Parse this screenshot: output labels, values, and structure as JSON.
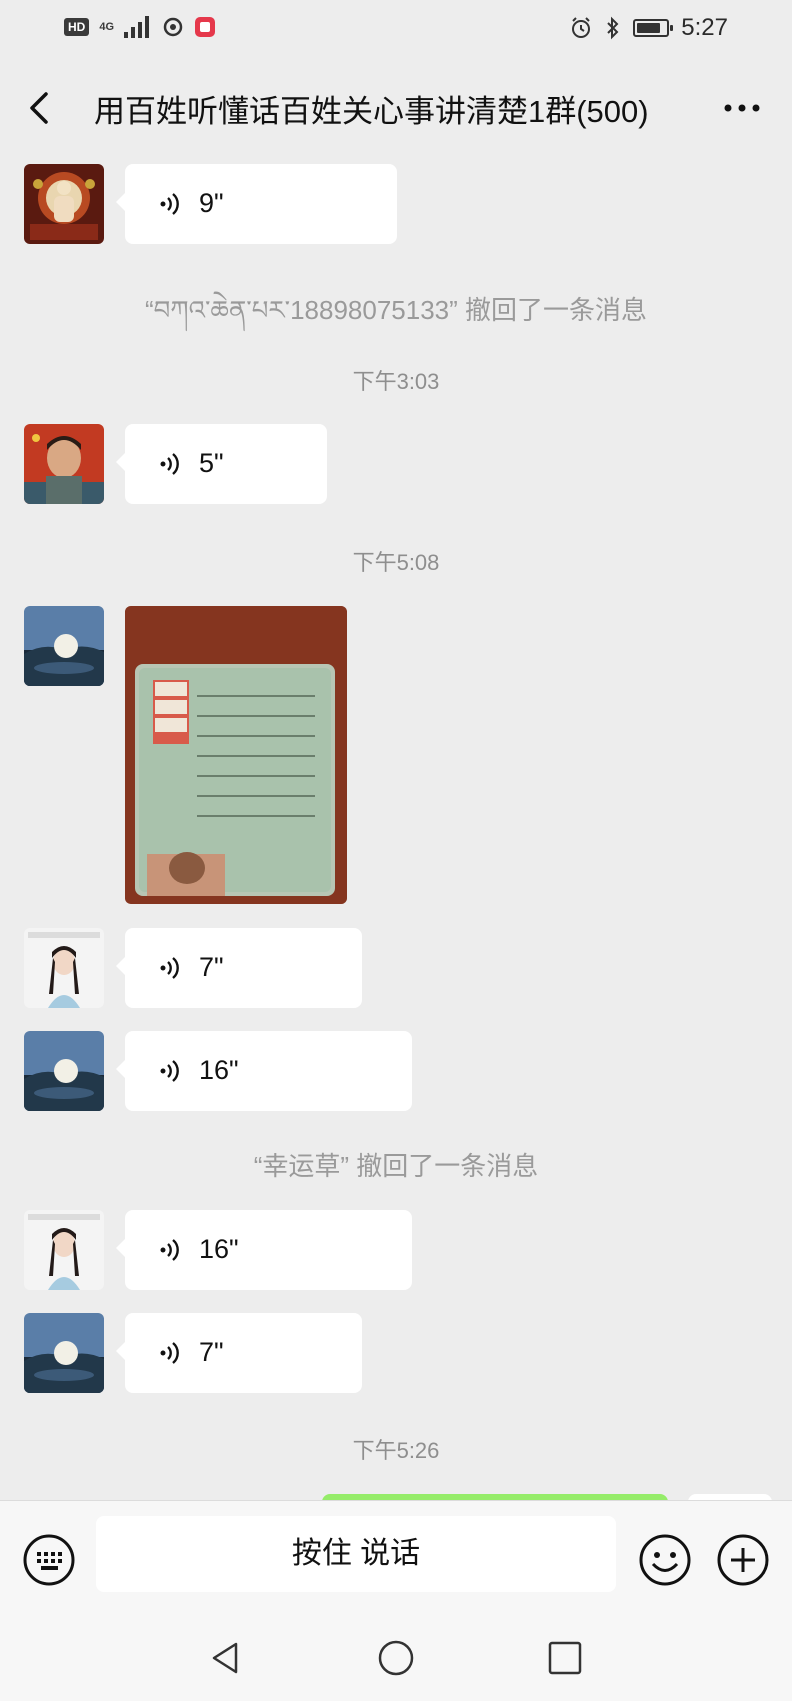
{
  "status_bar": {
    "hd_label": "HD",
    "network_label": "4G",
    "time": "5:27",
    "battery_level": 0.85
  },
  "header": {
    "title": "用百姓听懂话百姓关心事讲清楚1群(500)"
  },
  "messages": [
    {
      "type": "voice",
      "duration": "9\""
    },
    {
      "type": "system",
      "text": "“བཀའ་ཆེན་པར་18898075133” 撤回了一条消息"
    },
    {
      "type": "time",
      "text": "下午3:03"
    },
    {
      "type": "voice",
      "duration": "5\""
    },
    {
      "type": "time",
      "text": "下午5:08"
    },
    {
      "type": "image"
    },
    {
      "type": "voice",
      "duration": "7\""
    },
    {
      "type": "voice",
      "duration": "16\""
    },
    {
      "type": "system",
      "text": "“幸运草” 撤回了一条消息"
    },
    {
      "type": "voice",
      "duration": "16\""
    },
    {
      "type": "voice",
      "duration": "7\""
    },
    {
      "type": "time",
      "text": "下午5:26"
    }
  ],
  "input_bar": {
    "hold_to_talk": "按住 说话"
  },
  "colors": {
    "background": "#ededed",
    "bubble_in": "#ffffff",
    "bubble_out": "#95ec69",
    "system_text": "#9a9a9a"
  },
  "icons": [
    "back-arrow-icon",
    "more-icon",
    "voice-wave-icon",
    "keyboard-icon",
    "emoji-icon",
    "plus-icon",
    "nav-back-icon",
    "nav-home-icon",
    "nav-recent-icon"
  ]
}
